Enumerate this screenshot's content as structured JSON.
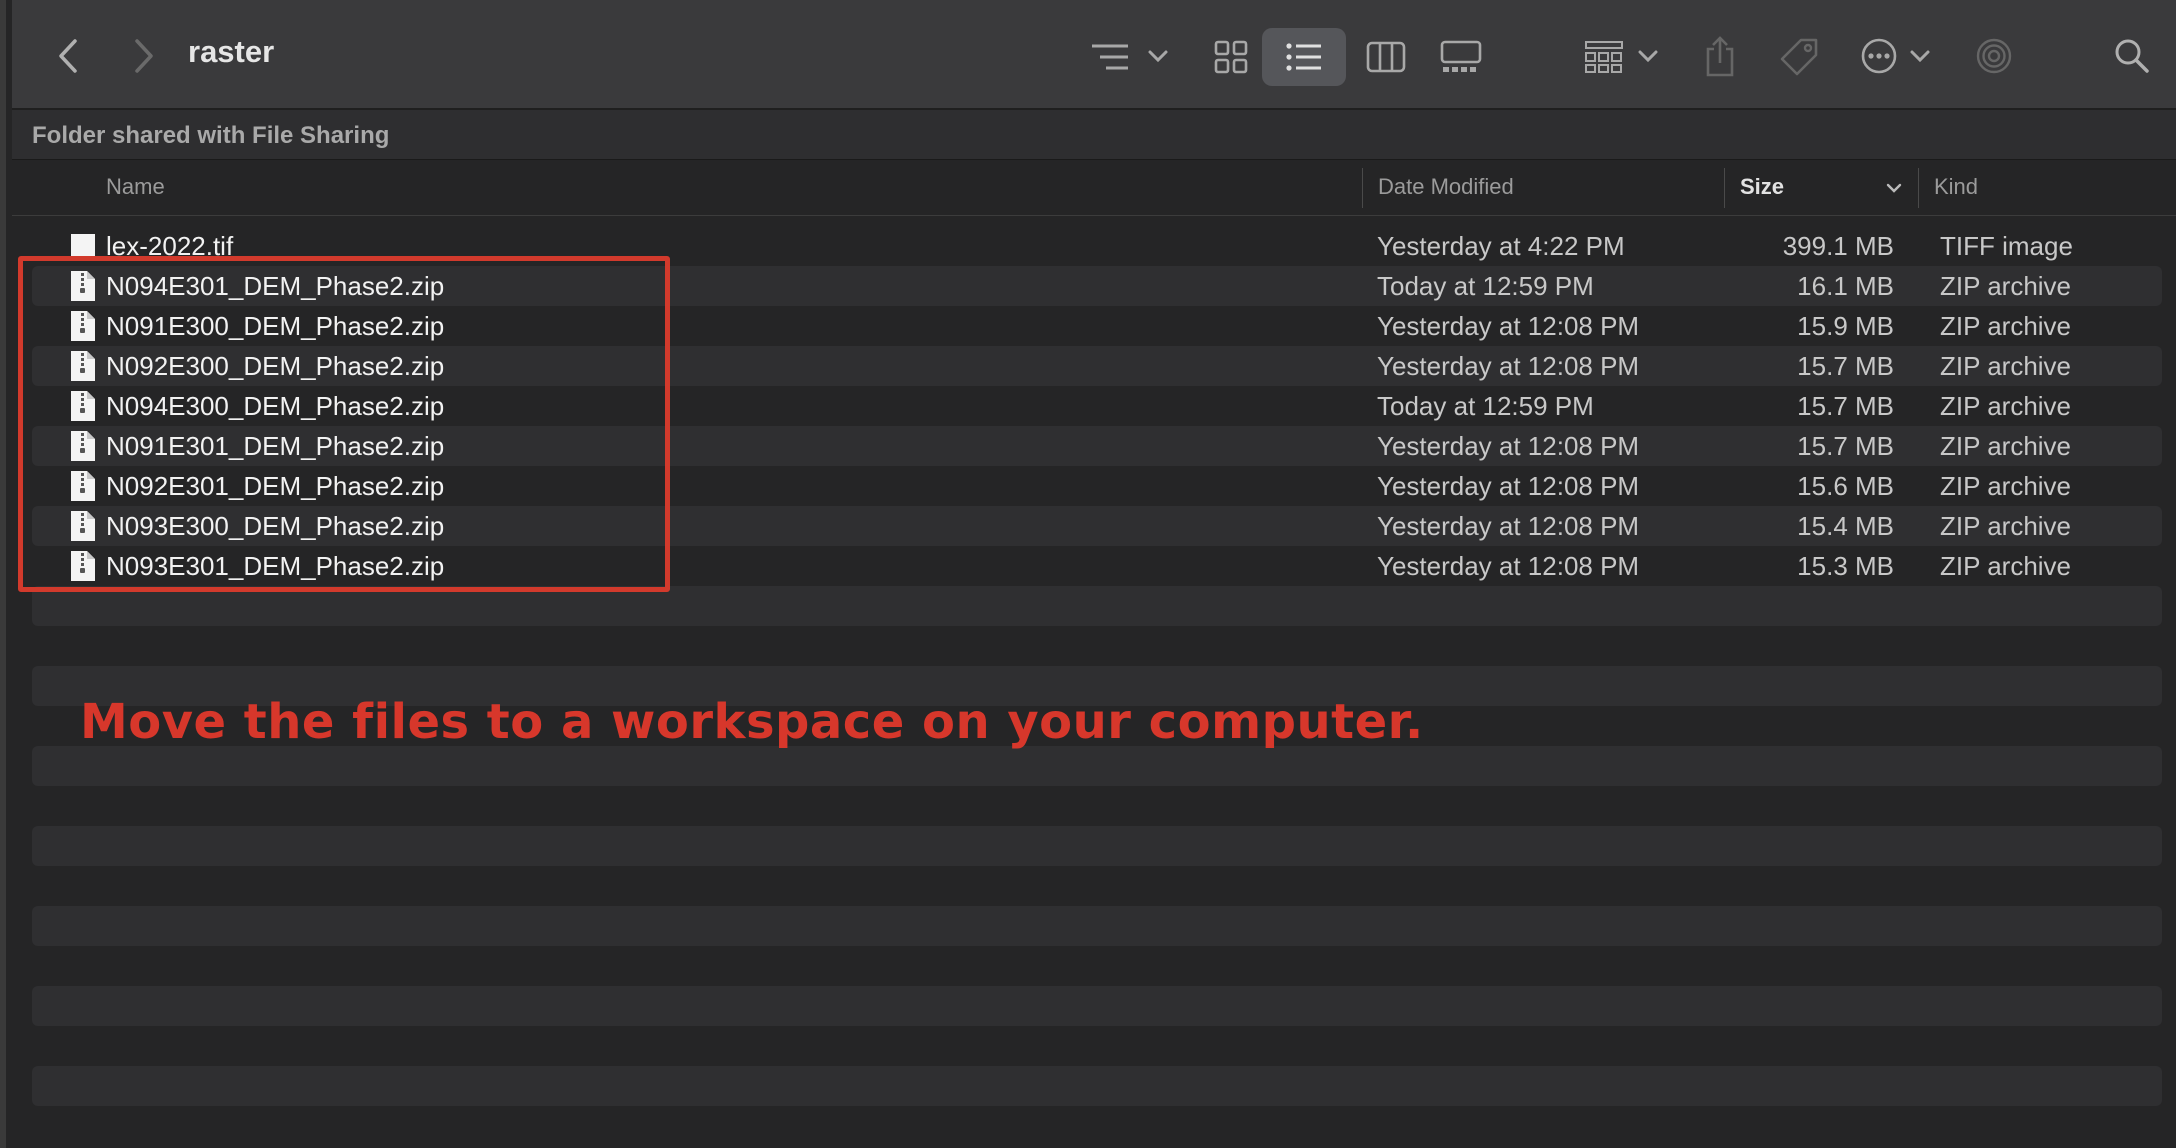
{
  "window": {
    "title": "raster",
    "path_label": "Folder shared with File Sharing"
  },
  "toolbar": {
    "icons": [
      "chevron-left-icon",
      "chevron-right-icon",
      "list-sort-icon",
      "icon-view-icon",
      "list-view-icon",
      "column-view-icon",
      "gallery-view-icon",
      "group-icon",
      "share-icon",
      "tag-icon",
      "more-icon",
      "airdrop-icon",
      "search-icon"
    ],
    "active_view": "list-view"
  },
  "columns": {
    "name": "Name",
    "date": "Date Modified",
    "size": "Size",
    "kind": "Kind",
    "sorted_by": "size"
  },
  "files": [
    {
      "name": "lex-2022.tif",
      "date": "Yesterday at 4:22 PM",
      "size": "399.1 MB",
      "kind": "TIFF image"
    },
    {
      "name": "N094E301_DEM_Phase2.zip",
      "date": "Today at 12:59 PM",
      "size": "16.1 MB",
      "kind": "ZIP archive"
    },
    {
      "name": "N091E300_DEM_Phase2.zip",
      "date": "Yesterday at 12:08 PM",
      "size": "15.9 MB",
      "kind": "ZIP archive"
    },
    {
      "name": "N092E300_DEM_Phase2.zip",
      "date": "Yesterday at 12:08 PM",
      "size": "15.7 MB",
      "kind": "ZIP archive"
    },
    {
      "name": "N094E300_DEM_Phase2.zip",
      "date": "Today at 12:59 PM",
      "size": "15.7 MB",
      "kind": "ZIP archive"
    },
    {
      "name": "N091E301_DEM_Phase2.zip",
      "date": "Yesterday at 12:08 PM",
      "size": "15.7 MB",
      "kind": "ZIP archive"
    },
    {
      "name": "N092E301_DEM_Phase2.zip",
      "date": "Yesterday at 12:08 PM",
      "size": "15.6 MB",
      "kind": "ZIP archive"
    },
    {
      "name": "N093E300_DEM_Phase2.zip",
      "date": "Yesterday at 12:08 PM",
      "size": "15.4 MB",
      "kind": "ZIP archive"
    },
    {
      "name": "N093E301_DEM_Phase2.zip",
      "date": "Yesterday at 12:08 PM",
      "size": "15.3 MB",
      "kind": "ZIP archive"
    }
  ],
  "annotation": {
    "text": "Move the files to a workspace on your computer.",
    "color": "#d7372b"
  },
  "colors": {
    "highlight_box": "#d23a2c",
    "toolbar_bg": "#3a3a3c",
    "list_bg": "#252526",
    "alt_row": "#2f2f31"
  }
}
